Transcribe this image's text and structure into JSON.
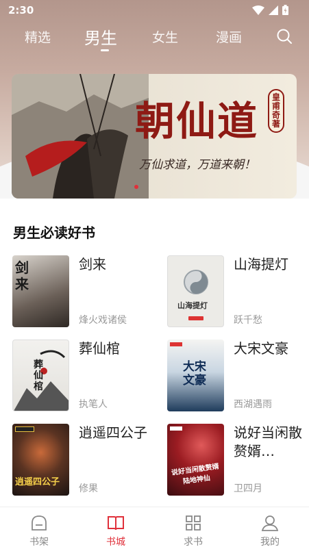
{
  "status": {
    "time": "2:30"
  },
  "top_tabs": [
    {
      "label": "精选"
    },
    {
      "label": "男生"
    },
    {
      "label": "女生"
    },
    {
      "label": "漫画"
    }
  ],
  "active_tab": "男生",
  "banner": {
    "title": "朝仙道",
    "author_seal": "皇甫奇著",
    "slogan": "万仙求道，万道来朝！"
  },
  "section": {
    "title": "男生必读好书"
  },
  "books": [
    {
      "title": "剑来",
      "author": "烽火戏诸侯",
      "cover_text": "剑来",
      "cover_color": "#5a5048"
    },
    {
      "title": "山海提灯",
      "author": "跃千愁",
      "cover_text": "山海提灯",
      "cover_color": "#eceae6"
    },
    {
      "title": "葬仙棺",
      "author": "执笔人",
      "cover_text": "葬仙棺",
      "cover_color": "#e8e6e2"
    },
    {
      "title": "大宋文豪",
      "author": "西湖遇雨",
      "cover_text": "大宋文豪",
      "cover_color": "#2c4a66"
    },
    {
      "title": "逍遥四公子",
      "author": "修果",
      "cover_text": "逍遥四公子",
      "cover_color": "#3a2a22"
    },
    {
      "title": "说好当闲散赘婿…",
      "author": "卫四月",
      "cover_text": "说好当闲散赘婿 陆地神仙",
      "cover_color": "#8a1e24"
    }
  ],
  "bottom_nav": [
    {
      "label": "书架",
      "icon": "bookshelf-icon"
    },
    {
      "label": "书城",
      "icon": "open-book-icon"
    },
    {
      "label": "求书",
      "icon": "grid-icon"
    },
    {
      "label": "我的",
      "icon": "user-icon"
    }
  ],
  "active_nav": "书城",
  "colors": {
    "accent": "#e0303a",
    "banner_red": "#8e1a14"
  }
}
